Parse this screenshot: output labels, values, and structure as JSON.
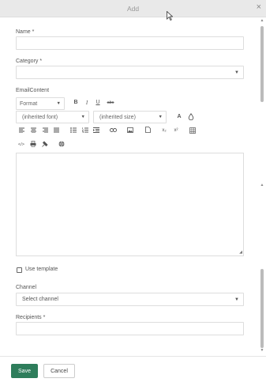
{
  "dialog": {
    "title": "Add",
    "close_icon": "×"
  },
  "form": {
    "name_label": "Name *",
    "category_label": "Category *",
    "email_content_label": "EmailContent",
    "use_template_label": "Use template",
    "channel_label": "Channel",
    "channel_value": "Select channel",
    "recipients_label": "Recipients *"
  },
  "toolbar": {
    "format": "Format",
    "font": "(inherited font)",
    "size": "(inherited size)",
    "bold": "B",
    "italic": "I",
    "underline": "U",
    "strike": "abc",
    "font_color": "A",
    "highlight_icon": "highlight-icon",
    "align_left_icon": "align-left-icon",
    "align_center_icon": "align-center-icon",
    "align_right_icon": "align-right-icon",
    "justify_icon": "justify-icon",
    "bullet_list_icon": "bullet-list-icon",
    "numbered_list_icon": "numbered-list-icon",
    "indent_icon": "indent-icon",
    "link_icon": "link-icon",
    "image_icon": "image-icon",
    "file_icon": "file-icon",
    "subscript": "x₂",
    "superscript": "x²",
    "table_icon": "table-icon",
    "source_code": "</>",
    "print_icon": "print-icon",
    "clean_icon": "clean-format-icon",
    "globe_icon": "globe-icon"
  },
  "footer": {
    "save": "Save",
    "cancel": "Cancel"
  },
  "colors": {
    "accent": "#2e7d5b",
    "titlebar": "#e9e9e9",
    "border": "#dddddd"
  }
}
